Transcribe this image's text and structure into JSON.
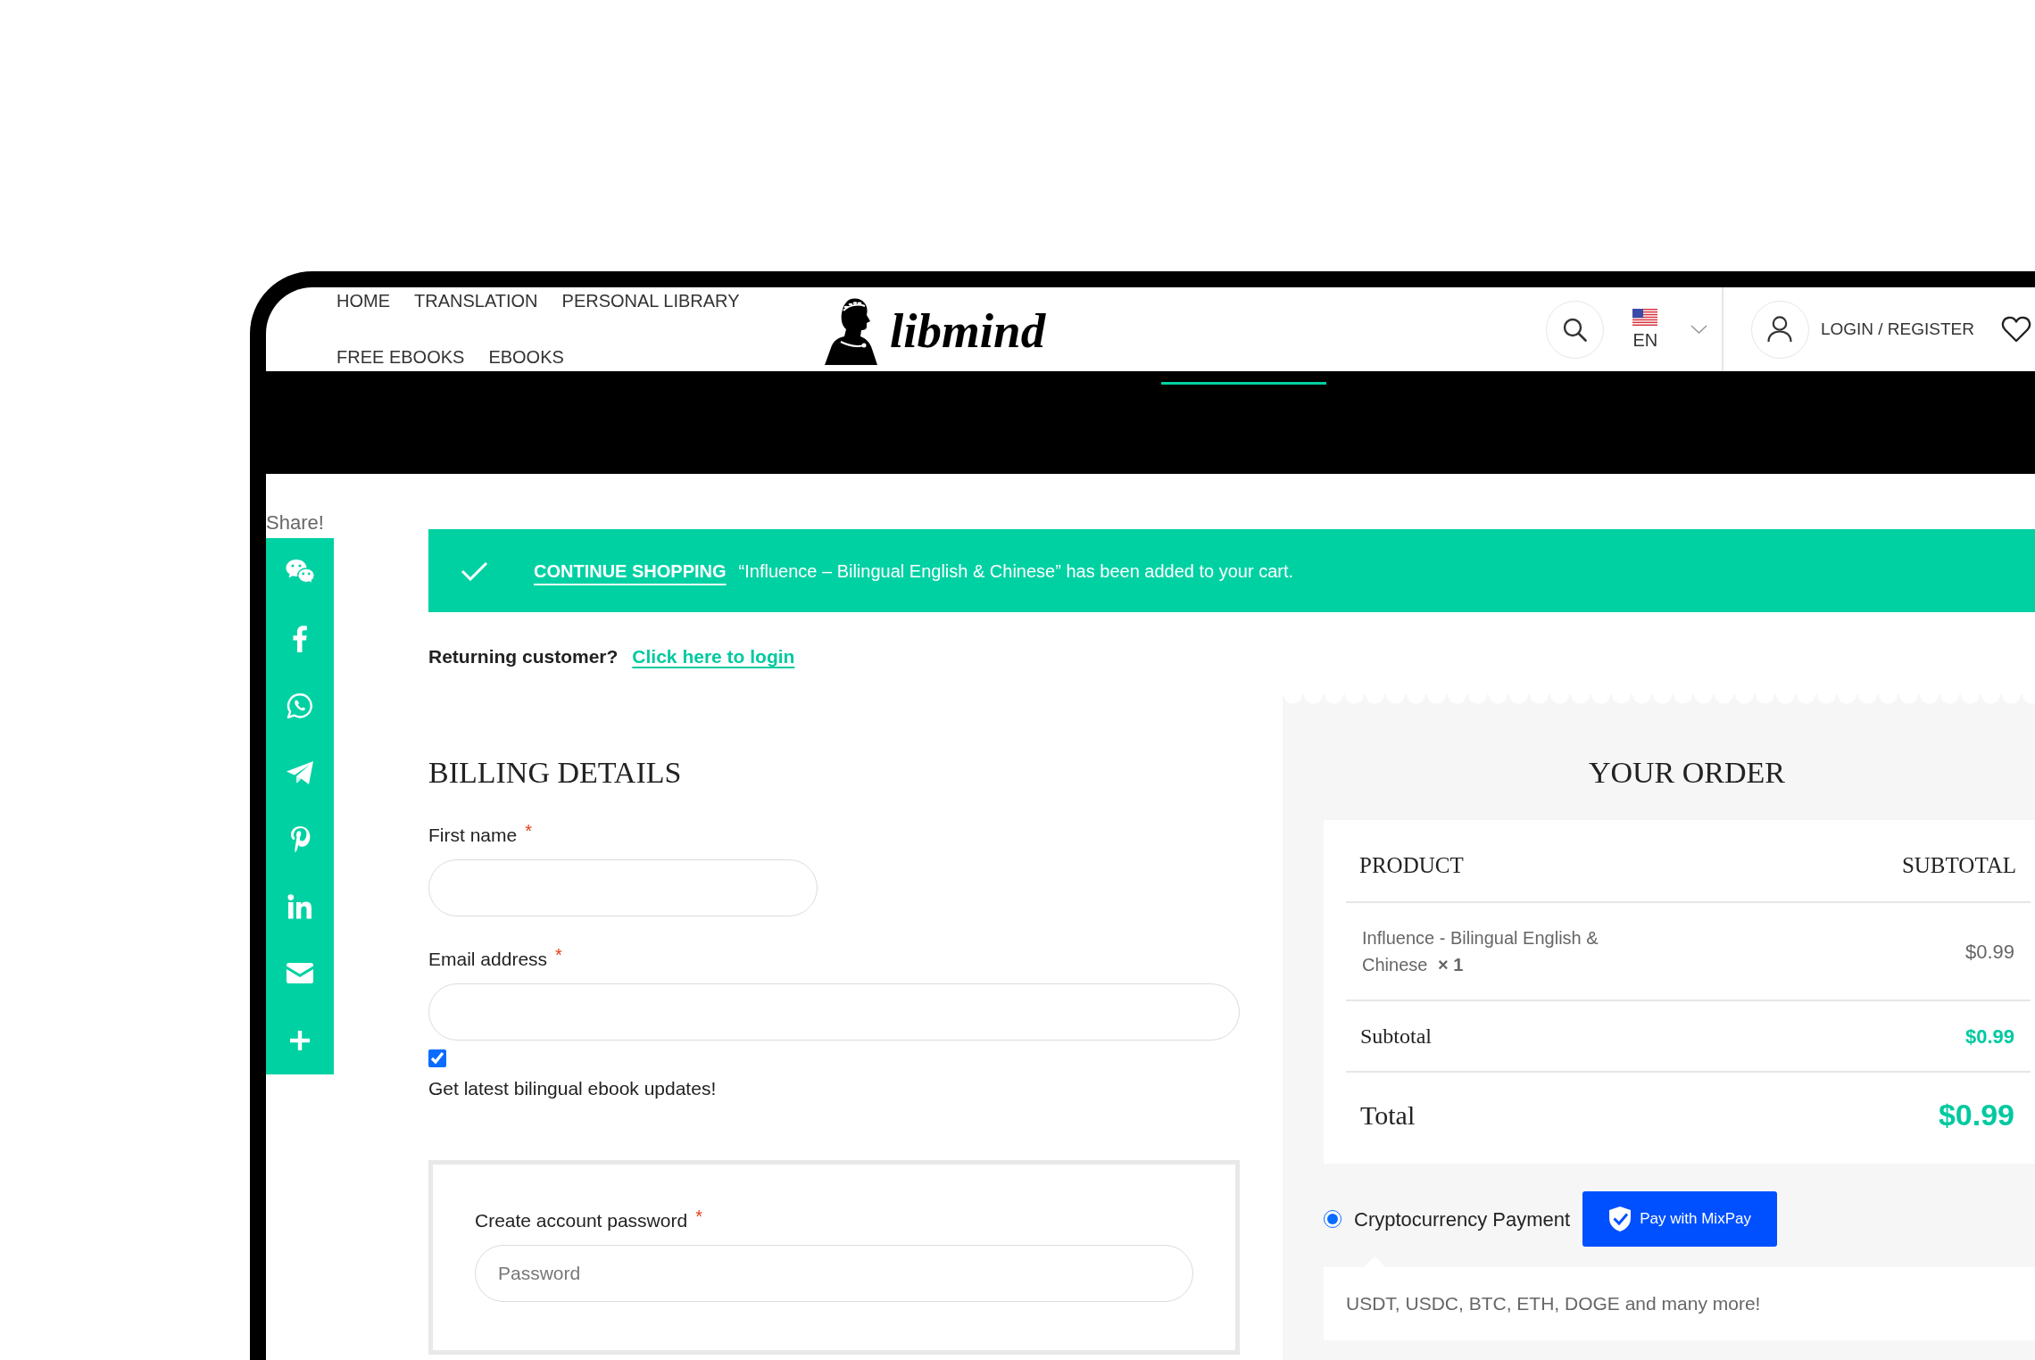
{
  "header": {
    "nav": [
      {
        "label": "HOME"
      },
      {
        "label": "TRANSLATION"
      },
      {
        "label": "PERSONAL LIBRARY"
      },
      {
        "label": "FREE EBOOKS"
      },
      {
        "label": "EBOOKS"
      }
    ],
    "logo": "libmind",
    "language": "EN",
    "account_link": "LOGIN / REGISTER"
  },
  "share": {
    "label": "Share!"
  },
  "notice": {
    "link": "CONTINUE SHOPPING",
    "message": "“Influence – Bilingual English & Chinese” has been added to your cart."
  },
  "login_prompt": {
    "text": "Returning customer?",
    "link": "Click here to login"
  },
  "billing": {
    "title": "BILLING DETAILS",
    "fields": [
      {
        "kind": "name",
        "label": "First name",
        "marker": "*"
      },
      {
        "kind": "email",
        "label": "Email address",
        "marker": "*"
      }
    ],
    "newsletter": {
      "label": "Get latest bilingual ebook updates!",
      "checked": true
    },
    "account_fields": [
      {
        "kind": "password",
        "label": "Create account password",
        "marker": "*",
        "placeholder": "Password"
      }
    ]
  },
  "order": {
    "title": "YOUR ORDER",
    "columns": [
      "PRODUCT",
      "SUBTOTAL"
    ],
    "items": [
      {
        "name": "Influence - Bilingual English & Chinese",
        "quantity": "× 1",
        "subtotal": "$0.99"
      }
    ],
    "totals": [
      {
        "kind": "subtotal",
        "label": "Subtotal",
        "value": "$0.99"
      },
      {
        "kind": "total",
        "label": "Total",
        "value": "$0.99"
      }
    ],
    "payment_methods": [
      {
        "label": "Cryptocurrency Payment",
        "selected": true,
        "button": "Pay with MixPay",
        "description": "USDT, USDC, BTC, ETH, DOGE and many more!"
      }
    ]
  }
}
